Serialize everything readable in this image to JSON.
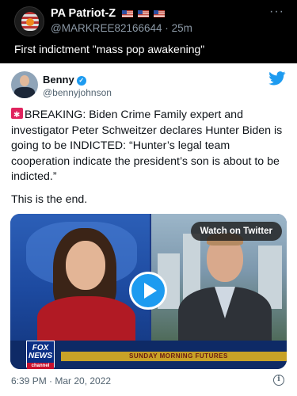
{
  "outer_tweet": {
    "author_name": "PA Patriot-Z",
    "handle": "@MARKREE82166644",
    "time": "25m",
    "separator": "·",
    "more": "···",
    "text": "First indictment \"mass pop awakening\"",
    "flag_count": 3
  },
  "embedded_tweet": {
    "author_name": "Benny",
    "handle": "@bennyjohnson",
    "body": "BREAKING: Biden Crime Family expert and investigator Peter Schweitzer declares Hunter Biden is going  to be INDICTED: “Hunter’s legal team cooperation indicate the president’s son is about to be indicted.”",
    "closing": "This is the end.",
    "video": {
      "watch_label": "Watch on Twitter",
      "network_logo": "FOX NEWS",
      "network_sub": "channel",
      "show_name": "SUNDAY MORNING FUTURES"
    },
    "timestamp": "6:39 PM · Mar 20, 2022",
    "info_icon": "i"
  },
  "colors": {
    "accent": "#1d9bf0",
    "background_dark": "#000000",
    "card_background": "#ffffff",
    "alert_red": "#e0245e"
  }
}
